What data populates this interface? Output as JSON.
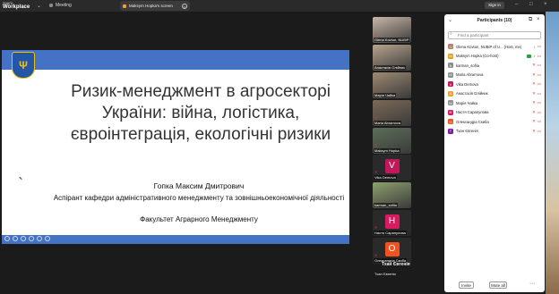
{
  "app": {
    "logo_line1": "zoom",
    "logo_line2": "Workplace",
    "meeting_label": "Meeting",
    "share_tab": "Maksym Hopka's screen",
    "signin": "Sign in"
  },
  "slide": {
    "title": "Ризик-менеджмент в агросекторі України: війна, логістика, євроінтеграція, екологічні ризики",
    "author": "Гопка Максим Дмитрович",
    "position": "Аспірант кафедри адміністративного менеджменту та зовнішньоекономічної діяльності",
    "faculty": "Факультет Аграрного Менеджменту",
    "crest_letter": "Ψ",
    "band_color": "#4472c4"
  },
  "gallery": {
    "tiles": [
      {
        "name": "Olena Kovtun, NUBiP",
        "kind": "video",
        "color": "#c9b7a8"
      },
      {
        "name": "Анастасія Олійник",
        "kind": "video",
        "color": "#b8a48e"
      },
      {
        "name": "Марія Чайка",
        "kind": "video",
        "color": "#9e8a73"
      },
      {
        "name": "Maria Abramova",
        "kind": "video",
        "color": "#7c6a58"
      },
      {
        "name": "Maksym Hopka",
        "kind": "video",
        "color": "#5d6f5a"
      },
      {
        "name": "Vika Demova",
        "kind": "avatar",
        "letter": "V",
        "color": "#c2185b"
      },
      {
        "name": "karman_sofiia",
        "kind": "video",
        "color": "#8ea06e"
      },
      {
        "name": "Настя Сарапулова",
        "kind": "avatar",
        "letter": "Н",
        "color": "#d81b60"
      },
      {
        "name": "Олександра Скиба",
        "kind": "avatar",
        "letter": "О",
        "color": "#f4511e"
      }
    ],
    "footer_name": "Тхан Євгенія",
    "footer_name2": "Тхан Євгенія"
  },
  "panel": {
    "title": "Participants (10)",
    "search_placeholder": "Find a participant",
    "participants": [
      {
        "initial": "O",
        "name": "Olena Kovtun, NUBiP of U... (Host, me)",
        "color": "#b07d62",
        "mic": "on",
        "share": false
      },
      {
        "initial": "M",
        "name": "Maksym Hopka (Co-host)",
        "color": "#e0a11b",
        "mic": "on",
        "share": true
      },
      {
        "initial": "k",
        "name": "karman_sofiia",
        "color": "#8e8e8e",
        "mic": "off",
        "share": false
      },
      {
        "initial": "M",
        "name": "Maria Abramova",
        "color": "#8e8e8e",
        "mic": "off",
        "share": false
      },
      {
        "initial": "V",
        "name": "Vika Demova",
        "color": "#c2185b",
        "mic": "off",
        "share": false
      },
      {
        "initial": "А",
        "name": "Анастасія Олійник",
        "color": "#f0a030",
        "mic": "off",
        "share": false
      },
      {
        "initial": "М",
        "name": "Марія Чайка",
        "color": "#8e8e8e",
        "mic": "off",
        "share": false
      },
      {
        "initial": "Н",
        "name": "Настя Сарапулова",
        "color": "#d81b60",
        "mic": "off",
        "share": false
      },
      {
        "initial": "О",
        "name": "Олександра Скиба",
        "color": "#f4511e",
        "mic": "off",
        "share": false
      },
      {
        "initial": "Т",
        "name": "Тхан Євгенія",
        "color": "#7b1fa2",
        "mic": "off",
        "share": false
      }
    ],
    "invite_label": "Invite",
    "mute_all_label": "Mute all"
  }
}
